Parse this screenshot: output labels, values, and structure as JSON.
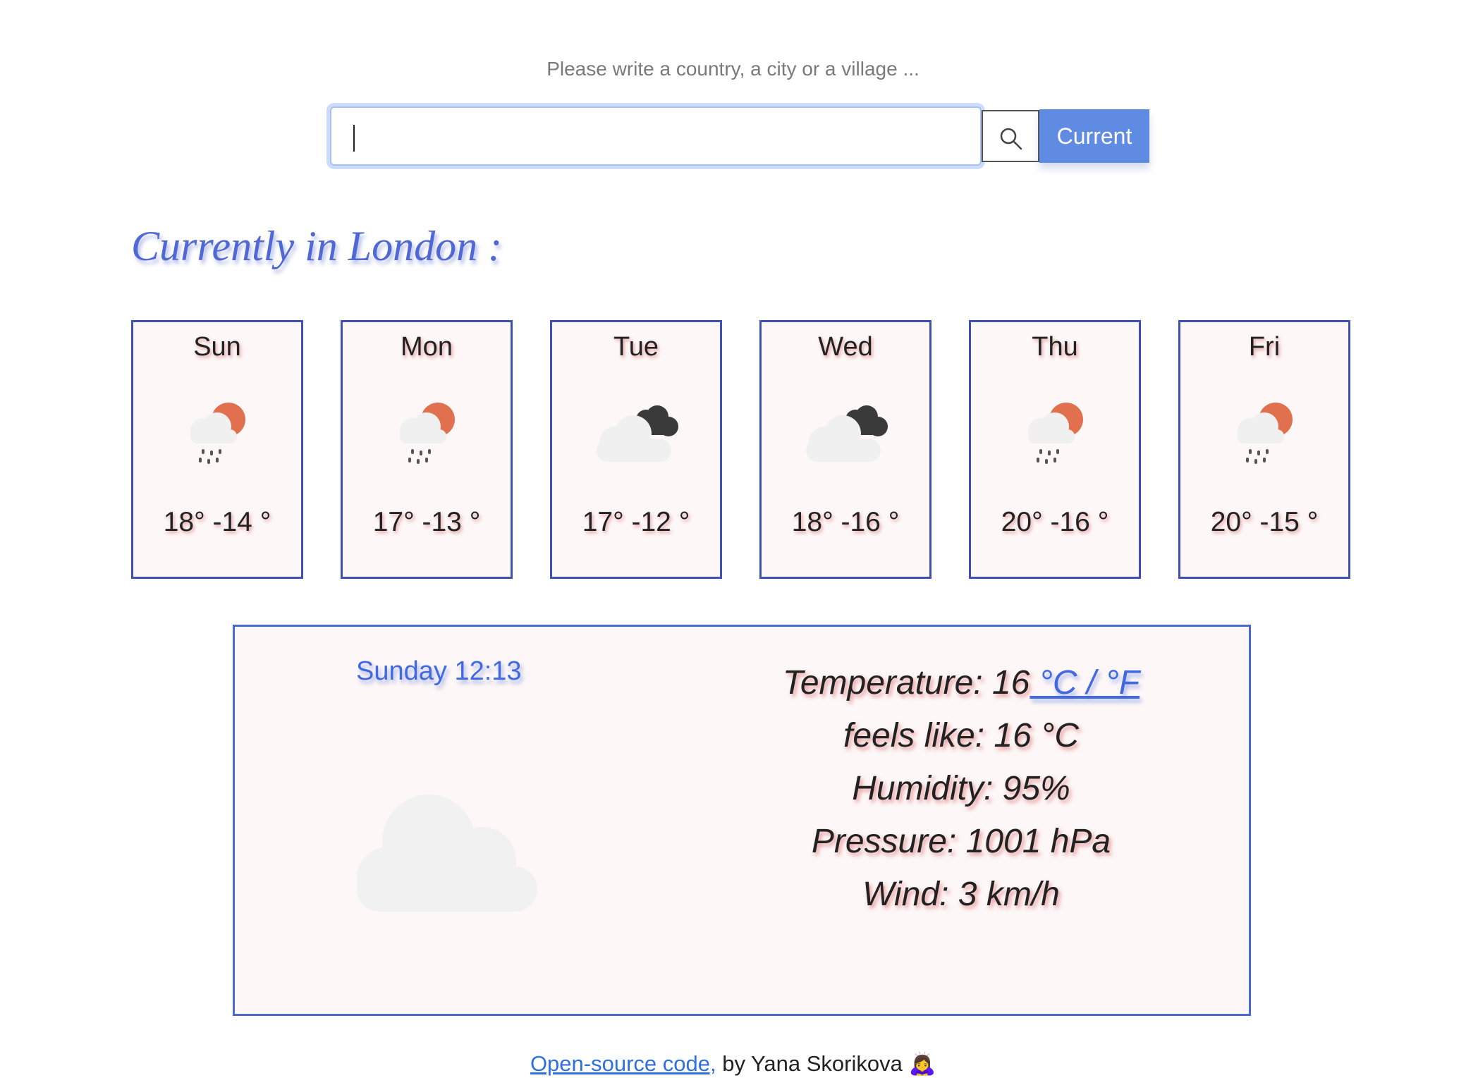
{
  "search": {
    "prompt": "Please write a country, a city or a village ...",
    "value": "",
    "search_icon": "magnifier-icon",
    "current_label": "Current"
  },
  "heading": "Currently in London :",
  "forecast": [
    {
      "day": "Sun",
      "temp": "18° -14 °",
      "icon": "rain-sun-icon"
    },
    {
      "day": "Mon",
      "temp": "17° -13 °",
      "icon": "rain-sun-icon"
    },
    {
      "day": "Tue",
      "temp": "17° -12 °",
      "icon": "dark-clouds-icon"
    },
    {
      "day": "Wed",
      "temp": "18° -16 °",
      "icon": "dark-clouds-icon"
    },
    {
      "day": "Thu",
      "temp": "20° -16 °",
      "icon": "rain-sun-icon"
    },
    {
      "day": "Fri",
      "temp": "20° -15 °",
      "icon": "rain-sun-icon"
    }
  ],
  "current": {
    "date": "Sunday 12:13",
    "icon": "cloud-icon",
    "temperature_label": "Temperature: 16",
    "unit_link": " °C / °F",
    "feels_like": "feels like: 16 °C",
    "humidity": "Humidity: 95%",
    "pressure": "Pressure: 1001 hPa",
    "wind": "Wind: 3 km/h"
  },
  "footer": {
    "link": "Open-source code,",
    "author": " by Yana Skorikova ",
    "emoji": "🙇‍♀️"
  },
  "colors": {
    "accent": "#4169e1",
    "button": "#5f8be3",
    "card_border": "#3f51b5",
    "card_bg": "#fdf7f7",
    "sun": "#e0704e"
  }
}
